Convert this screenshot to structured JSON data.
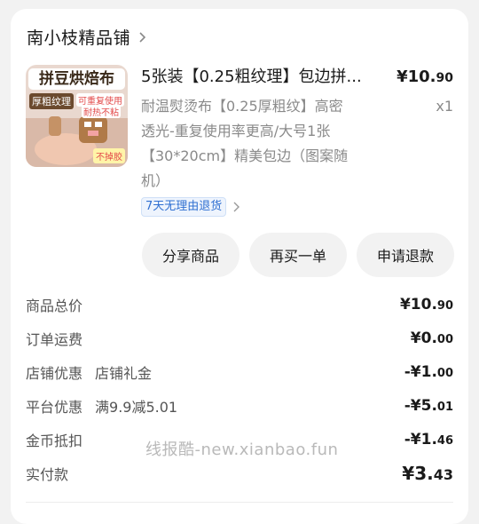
{
  "shop": {
    "name": "南小枝精品铺"
  },
  "product": {
    "title": "5张装【0.25粗纹理】包边拼...",
    "price_main": "¥10.",
    "price_cents": "90",
    "desc_lines": [
      "耐温熨烫布【0.25厚粗纹】高密",
      "透光-重复使用率更高/大号1张",
      "【30*20cm】精美包边（图案随",
      "机）"
    ],
    "qty": "x1",
    "tag": "7天无理由退货",
    "image_text": {
      "top": "拼豆烘焙布",
      "left": "厚粗纹理",
      "right": "可重复使用",
      "right2": "耐热不粘",
      "bottom": "不掉胶"
    }
  },
  "actions": {
    "share": "分享商品",
    "rebuy": "再买一单",
    "refund": "申请退款"
  },
  "fees": [
    {
      "label": "商品总价",
      "sub": "",
      "main": "¥10.",
      "cents": "90"
    },
    {
      "label": "订单运费",
      "sub": "",
      "main": "¥0.",
      "cents": "00"
    },
    {
      "label": "店铺优惠",
      "sub": "店铺礼金",
      "main": "-¥1.",
      "cents": "00"
    },
    {
      "label": "平台优惠",
      "sub": "满9.9减5.01",
      "main": "-¥5.",
      "cents": "01"
    },
    {
      "label": "金币抵扣",
      "sub": "",
      "main": "-¥1.",
      "cents": "46"
    }
  ],
  "total": {
    "label": "实付款",
    "main": "¥3.",
    "cents": "43"
  },
  "watermark": "线报酷-new.xianbao.fun"
}
